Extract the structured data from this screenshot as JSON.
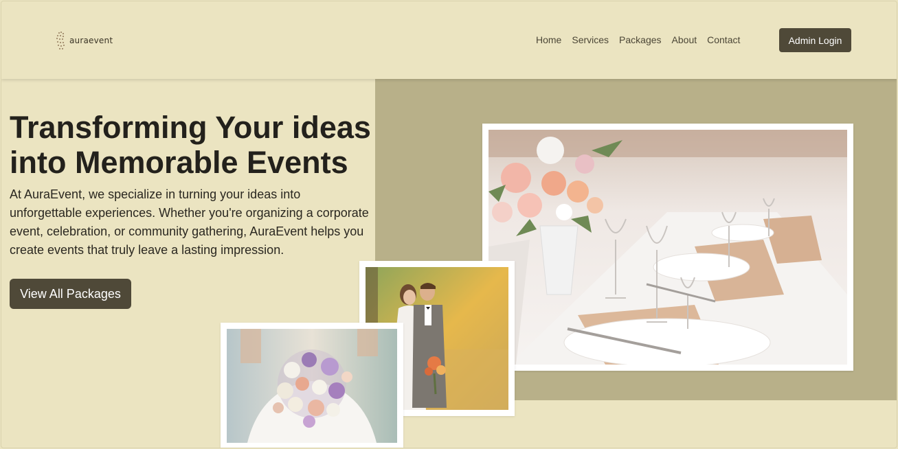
{
  "brand": {
    "name": "auraevent"
  },
  "nav": {
    "items": [
      {
        "label": "Home"
      },
      {
        "label": "Services"
      },
      {
        "label": "Packages"
      },
      {
        "label": "About"
      },
      {
        "label": "Contact"
      }
    ],
    "admin_label": "Admin Login"
  },
  "hero": {
    "title": "Transforming Your ideas into Memorable Events",
    "description": "At AuraEvent, we specialize in turning your ideas into unforgettable experiences. Whether you're organizing a corporate event, celebration, or community gathering, AuraEvent helps you create events that truly leave a lasting impression.",
    "cta_label": "View All Packages"
  },
  "colors": {
    "page_bg": "#ebe4c1",
    "panel_bg": "#b8b089",
    "button_bg": "#4f4938"
  },
  "images": [
    {
      "subject": "banquet table with floral centerpiece"
    },
    {
      "subject": "wedding couple by lake"
    },
    {
      "subject": "bridal bouquet"
    }
  ]
}
